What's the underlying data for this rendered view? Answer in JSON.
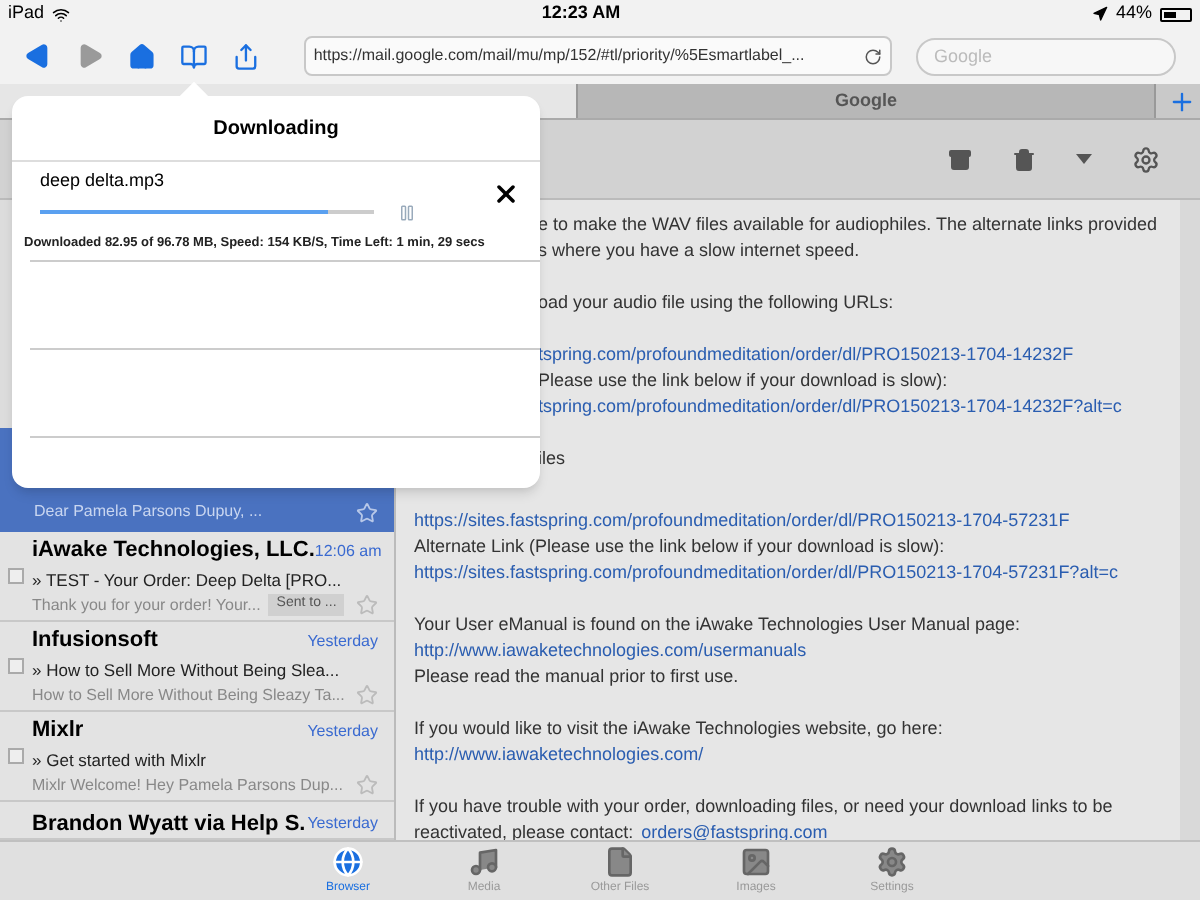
{
  "status_bar": {
    "device": "iPad",
    "time": "12:23 AM",
    "battery": "44%"
  },
  "toolbar": {
    "back_enabled": true,
    "forward_enabled": false,
    "url": "https://mail.google.com/mail/mu/mp/152/#tl/priority/%5Esmartlabel_...",
    "search": {
      "placeholder": "Google"
    }
  },
  "tabs": [
    {
      "label": "Google",
      "selected": false
    }
  ],
  "emails": [
    {
      "selected": true,
      "snippet": "Dear Pamela Parsons Dupuy, ..."
    },
    {
      "selected": false,
      "sender": "iAwake Technologies, LLC.",
      "time": "12:06 am",
      "marker": "»",
      "subject": "TEST - Your Order: Deep Delta [PRO...",
      "snippet": "Thank you for your order! Your...",
      "tag": "Sent to ..."
    },
    {
      "selected": false,
      "sender": "Infusionsoft",
      "time": "Yesterday",
      "marker": "»",
      "subject": "How to Sell More Without Being Slea...",
      "snippet": "How to Sell More Without Being Sleazy Ta..."
    },
    {
      "selected": false,
      "sender": "Mixlr",
      "time": "Yesterday",
      "marker": "»",
      "subject": "Get started with Mixlr",
      "snippet": "Mixlr Welcome! Hey Pamela Parsons Dup..."
    },
    {
      "selected": false,
      "sender": "Brandon Wyatt via Help S.",
      "time": "Yesterday"
    }
  ],
  "content": {
    "partial_paragraphs": [
      [
        {
          "text": "e to make the WAV files available for audiophiles. The alternate links provided"
        },
        {
          "text": "s where you have a slow internet speed."
        }
      ],
      [
        {
          "text": "oad your audio file using the following URLs:"
        }
      ],
      [
        {
          "link": "tspring.com/profoundmeditation/order/dl/PRO150213-1704-14232F"
        },
        {
          "text": "Please use the link below if your download is slow):"
        },
        {
          "link": "tspring.com/profoundmeditation/order/dl/PRO150213-1704-14232F?alt=c"
        }
      ],
      [
        {
          "text": "iles"
        }
      ]
    ],
    "paragraphs": [
      [
        {
          "link": "https://sites.fastspring.com/profoundmeditation/order/dl/PRO150213-1704-57231F"
        },
        {
          "text": "Alternate Link (Please use the link below if your download is slow):"
        },
        {
          "link": "https://sites.fastspring.com/profoundmeditation/order/dl/PRO150213-1704-57231F?alt=c"
        }
      ],
      [
        {
          "text": "Your User eManual is found on the iAwake Technologies User Manual page:"
        },
        {
          "link": "http://www.iawaketechnologies.com/usermanuals"
        },
        {
          "text": "Please read the manual prior to first use."
        }
      ],
      [
        {
          "text": "If you would like to visit the iAwake Technologies website, go here:"
        },
        {
          "link": "http://www.iawaketechnologies.com/"
        }
      ],
      [
        {
          "text": "If you have trouble with your order, downloading files, or need your download links to be"
        },
        {
          "text": "reactivated, please contact:",
          "link": "orders@fastspring.com"
        }
      ]
    ]
  },
  "downloads": {
    "title": "Downloading",
    "items": [
      {
        "name": "deep delta.mp3",
        "level": 0.86,
        "info": "Downloaded 82.95 of 96.78 MB, Speed: 154 KB/S, Time Left: 1 min, 29 secs"
      }
    ]
  },
  "bottom_tabs": [
    {
      "label": "Browser",
      "kind": "browser",
      "selected": true
    },
    {
      "label": "Media",
      "kind": "media",
      "selected": false
    },
    {
      "label": "Other Files",
      "kind": "files",
      "selected": false
    },
    {
      "label": "Images",
      "kind": "images",
      "selected": false
    },
    {
      "label": "Settings",
      "kind": "settings",
      "selected": false
    }
  ]
}
